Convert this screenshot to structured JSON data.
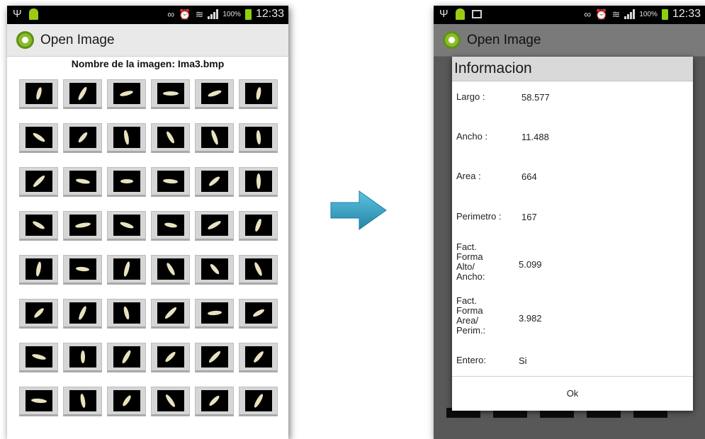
{
  "left": {
    "status_time": "12:33",
    "battery": "100%",
    "app_title": "Open Image",
    "image_name": "Nombre de la imagen: Ima3.bmp",
    "thumbnail_icon": "rice-grain-thumbnail"
  },
  "right": {
    "status_time": "12:33",
    "battery": "100%",
    "app_title": "Open Image",
    "dialog": {
      "title": "Informacion",
      "rows": [
        {
          "label": "Largo :",
          "value": "58.577"
        },
        {
          "label": "Ancho :",
          "value": "11.488"
        },
        {
          "label": "Area :",
          "value": "664"
        },
        {
          "label": "Perimetro :",
          "value": "167"
        },
        {
          "label": "Fact.\nForma\nAlto/\nAncho:",
          "value": "5.099"
        },
        {
          "label": "Fact.\nForma\nArea/\nPerim.:",
          "value": "3.982"
        },
        {
          "label": "Entero:",
          "value": "Si"
        }
      ],
      "ok_label": "Ok"
    }
  },
  "colors": {
    "status_bg": "#000000",
    "titlebar_bg": "#e9e9e9",
    "dialog_title_bg": "#d9d9d9",
    "arrow": "#3aa7c9",
    "dim_overlay": "#585858"
  }
}
